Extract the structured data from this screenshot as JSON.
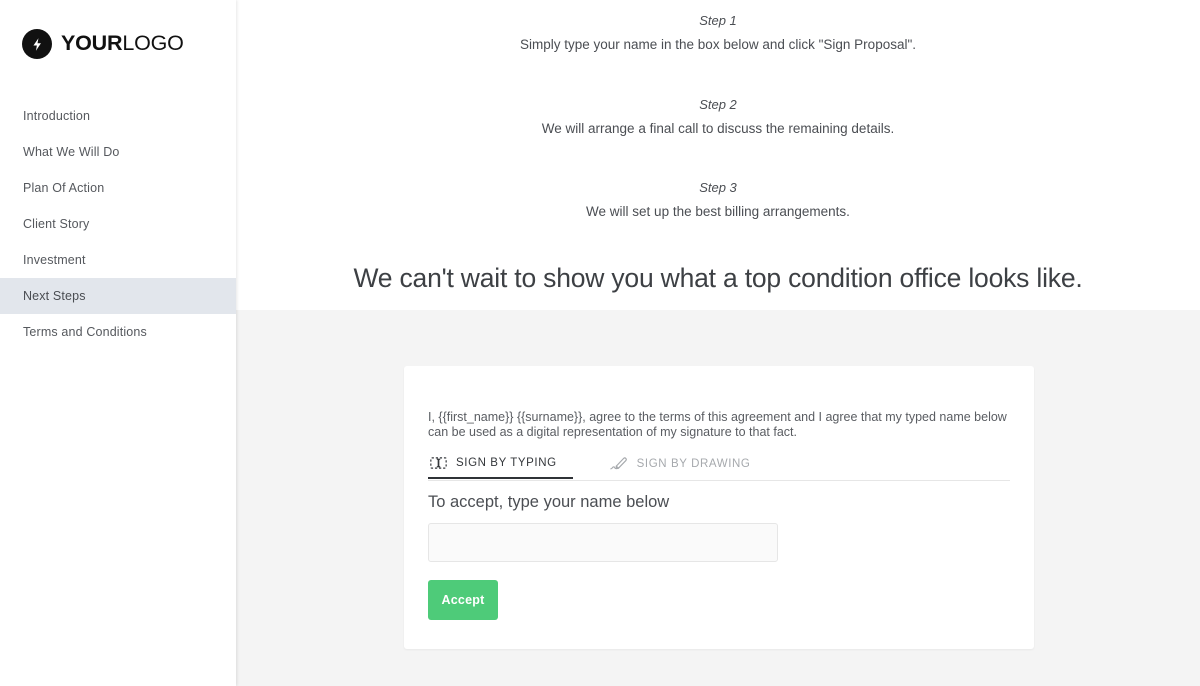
{
  "sidebar": {
    "logo": {
      "icon": "lightning-bolt-icon",
      "bold_part": "YOUR",
      "light_part": "LOGO"
    },
    "items": [
      {
        "label": "Introduction",
        "active": false
      },
      {
        "label": "What We Will Do",
        "active": false
      },
      {
        "label": "Plan Of Action",
        "active": false
      },
      {
        "label": "Client Story",
        "active": false
      },
      {
        "label": "Investment",
        "active": false
      },
      {
        "label": "Next Steps",
        "active": true
      },
      {
        "label": "Terms and Conditions",
        "active": false
      }
    ],
    "active_item": "Next Steps",
    "active_highlight_color": "#e2e6ec"
  },
  "main": {
    "steps": [
      {
        "label": "Step 1",
        "text": "Simply type your name in the box below and click \"Sign Proposal\"."
      },
      {
        "label": "Step 2",
        "text": "We will arrange a final call to discuss the remaining details."
      },
      {
        "label": "Step 3",
        "text": "We will set up the best billing arrangements."
      }
    ],
    "headline": "We can't wait to show you what a top condition office looks like."
  },
  "signature_card": {
    "agreement_text": "I, {{first_name}} {{surname}}, agree to the terms of this agreement and I agree that my typed name below can be used as a digital representation of my signature to that fact.",
    "tabs": [
      {
        "label": "SIGN BY TYPING",
        "icon": "text-input-cursor-icon",
        "active": true
      },
      {
        "label": "SIGN BY DRAWING",
        "icon": "pen-signature-icon",
        "active": false
      }
    ],
    "accept_label": "To accept, type your name below",
    "name_input": {
      "value": "",
      "placeholder": ""
    },
    "accept_button": {
      "label": "Accept",
      "color": "#4ecb79"
    }
  }
}
